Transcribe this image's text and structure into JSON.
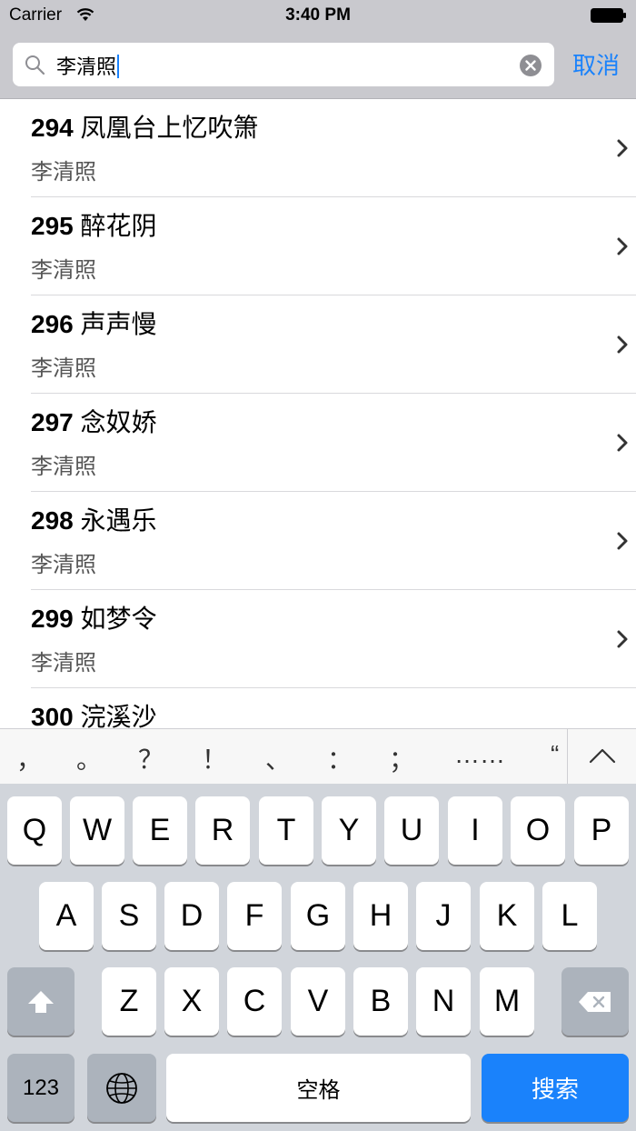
{
  "status_bar": {
    "carrier": "Carrier",
    "time": "3:40 PM"
  },
  "search": {
    "query": "李清照",
    "cancel_label": "取消"
  },
  "results": [
    {
      "number": "294",
      "title": "凤凰台上忆吹箫",
      "author": "李清照"
    },
    {
      "number": "295",
      "title": "醉花阴",
      "author": "李清照"
    },
    {
      "number": "296",
      "title": "声声慢",
      "author": "李清照"
    },
    {
      "number": "297",
      "title": "念奴娇",
      "author": "李清照"
    },
    {
      "number": "298",
      "title": "永遇乐",
      "author": "李清照"
    },
    {
      "number": "299",
      "title": "如梦令",
      "author": "李清照"
    },
    {
      "number": "300",
      "title": "浣溪沙",
      "author": ""
    }
  ],
  "candidates": [
    "，",
    "。",
    "？",
    "！",
    "、",
    "：",
    "；",
    "……",
    "“"
  ],
  "keyboard": {
    "row1": [
      "Q",
      "W",
      "E",
      "R",
      "T",
      "Y",
      "U",
      "I",
      "O",
      "P"
    ],
    "row2": [
      "A",
      "S",
      "D",
      "F",
      "G",
      "H",
      "J",
      "K",
      "L"
    ],
    "row3": [
      "Z",
      "X",
      "C",
      "V",
      "B",
      "N",
      "M"
    ],
    "numbers_label": "123",
    "space_label": "空格",
    "search_label": "搜索"
  },
  "colors": {
    "accent": "#1a82fb",
    "bar_gray": "#c9c9ce",
    "keyboard_bg": "#d1d5db"
  },
  "icons": {
    "search": "search-icon",
    "clear": "clear-icon",
    "chevron": "chevron-right-icon",
    "shift": "shift-icon",
    "delete": "delete-icon",
    "globe": "globe-icon"
  }
}
